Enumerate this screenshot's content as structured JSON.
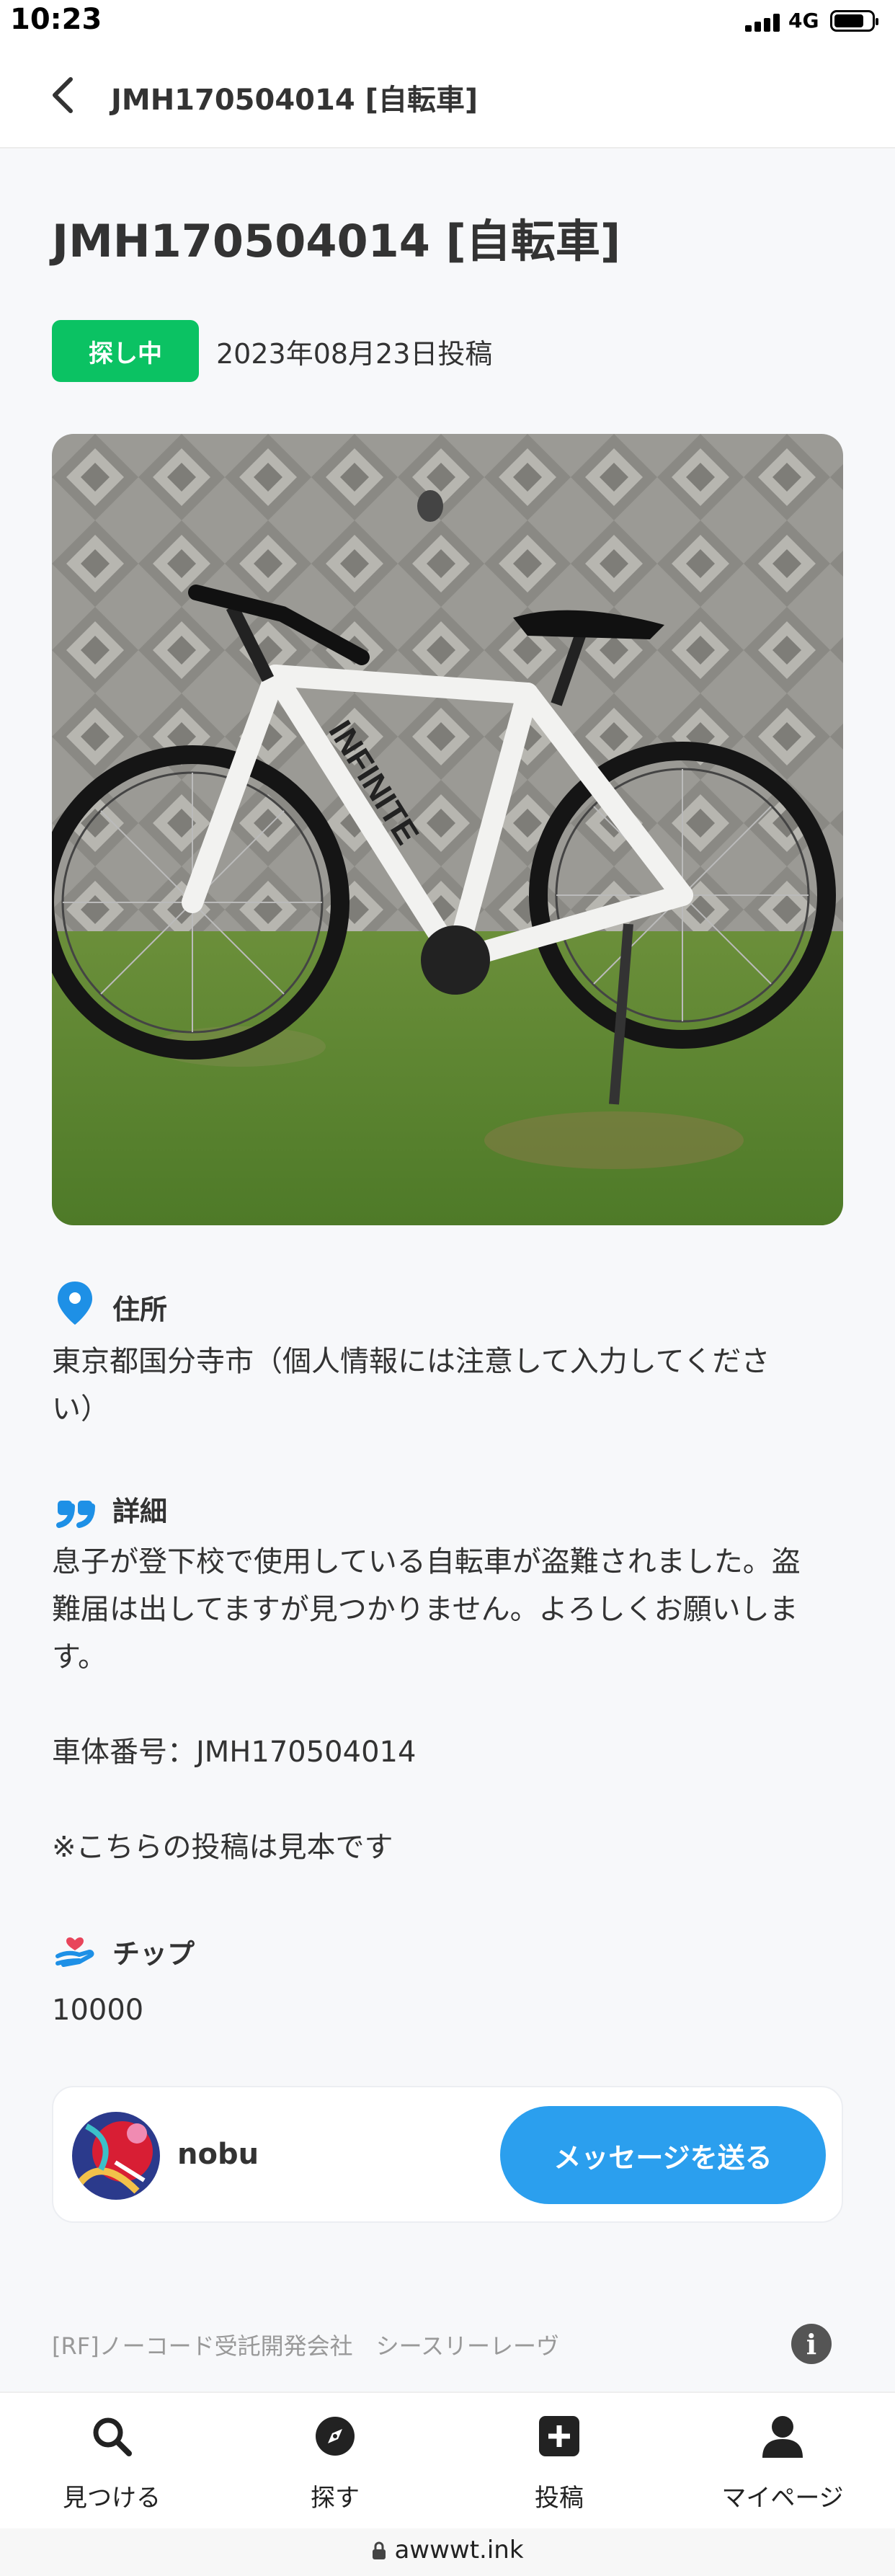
{
  "status_bar": {
    "time": "10:23",
    "network": "4G"
  },
  "header": {
    "title": "JMH170504014 [自転車]"
  },
  "post": {
    "title": "JMH170504014 [自転車]",
    "status": "探し中",
    "posted_date": "2023年08月23日投稿",
    "status_color": "#0bc263"
  },
  "address": {
    "label": "住所",
    "text": "東京都国分寺市（個人情報には注意して入力してくださ\nい）"
  },
  "details": {
    "label": "詳細",
    "text": "息子が登下校で使用している自転車が盗難されました。盗\n難届は出してますが見つかりません。よろしくお願いしま\nす。\n\n車体番号：JMH170504014\n\n※こちらの投稿は見本です"
  },
  "tip": {
    "label": "チップ",
    "amount": "10000"
  },
  "user": {
    "name": "nobu",
    "message_button": "メッセージを送る"
  },
  "footer": {
    "credit": "[RF]ノーコード受託開発会社　シースリーレーヴ"
  },
  "tabs": [
    {
      "label": "見つける",
      "icon": "search-icon"
    },
    {
      "label": "探す",
      "icon": "compass-icon"
    },
    {
      "label": "投稿",
      "icon": "plus-square-icon"
    },
    {
      "label": "マイページ",
      "icon": "person-icon"
    }
  ],
  "browser": {
    "url": "awwwt.ink"
  },
  "colors": {
    "accent_blue": "#2b9fee",
    "badge_green": "#0bc263",
    "icon_blue": "#1e90e6"
  }
}
